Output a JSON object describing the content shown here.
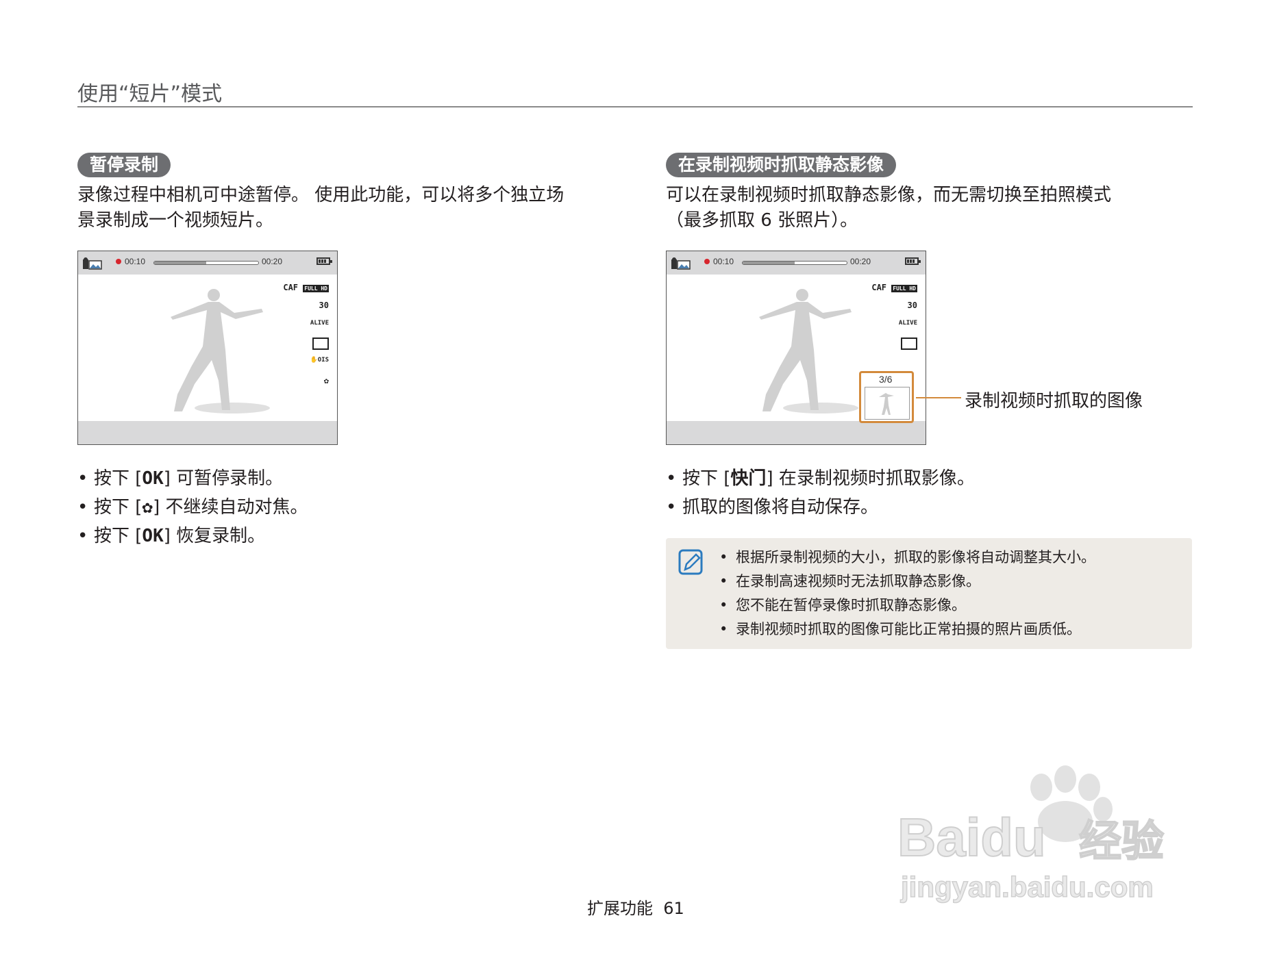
{
  "page": {
    "header": "使用“短片”模式",
    "footer_section": "扩展功能",
    "footer_page": "61"
  },
  "left": {
    "pill": "暂停录制",
    "intro_line1": "录像过程中相机可中途暂停。 使用此功能，可以将多个独立场",
    "intro_line2": "景录制成一个视频短片。",
    "bullets": [
      {
        "pre": "按下 [",
        "key": "OK",
        "post": "] 可暂停录制。"
      },
      {
        "pre": "按下 [",
        "key": "✿",
        "post": "] 不继续自动对焦。"
      },
      {
        "pre": "按下 [",
        "key": "OK",
        "post": "] 恢复录制。"
      }
    ]
  },
  "right": {
    "pill": "在录制视频时抓取静态影像",
    "intro_line1": "可以在录制视频时抓取静态影像，而无需切换至拍照模式",
    "intro_line2": "（最多抓取 6 张照片）。",
    "capture_count": "3/6",
    "callout": "录制视频时抓取的图像",
    "bullets": [
      {
        "pre": "按下 [",
        "key": "快门",
        "post": "] 在录制视频时抓取影像。"
      },
      {
        "pre": "抓取的图像将自动保存。",
        "key": "",
        "post": ""
      }
    ],
    "notes": [
      "根据所录制视频的大小，抓取的影像将自动调整其大小。",
      "在录制高速视频时无法抓取静态影像。",
      "您不能在暂停录像时抓取静态影像。",
      "录制视频时抓取的图像可能比正常拍摄的照片画质低。"
    ]
  },
  "screen": {
    "time_elapsed": "00:10",
    "time_total": "00:20",
    "progress": 0.5,
    "icon_caf": "CAF",
    "icon_fullhd": "FULL HD",
    "icon_30": "30",
    "icon_alive": "ALIVE",
    "icon_ois": "OIS",
    "bullet": "•"
  },
  "watermark": {
    "brand": "Baidu",
    "suffix": "经验",
    "url": "jingyan.baidu.com"
  },
  "colors": {
    "accent": "#d38a3b",
    "pill": "#6d6e71",
    "note_bg": "#eeebe6",
    "rec": "#d7262e",
    "note_icon": "#2b7bbf"
  }
}
